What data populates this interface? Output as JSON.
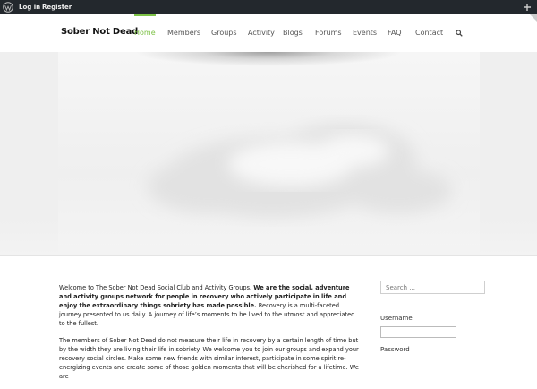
{
  "admin_bar": {
    "login": "Log in",
    "register": "Register",
    "icons": [
      "wordpress-icon",
      "add-icon"
    ]
  },
  "header": {
    "logo": "Sober Not Dead",
    "nav": [
      {
        "label": "Home",
        "active": true
      },
      {
        "label": "Members"
      },
      {
        "label": "Groups"
      },
      {
        "label": "Activity"
      },
      {
        "label": "Blogs"
      },
      {
        "label": "Forums"
      },
      {
        "label": "Events"
      },
      {
        "label": "FAQ"
      },
      {
        "label": "Contact"
      }
    ],
    "accent_color": "#7dc246",
    "search_icon": "search-icon"
  },
  "main": {
    "p1_a": "Welcome to The Sober Not Dead Social Club and Activity Groups. ",
    "p1_bold": "We are the social, adventure and activity groups network for people in recovery who actively participate in life and enjoy the extraordinary things sobriety has made possible.",
    "p1_b": " Recovery is a multi-faceted journey presented to us daily.  A journey of life’s moments to be lived to the utmost and appreciated to the fullest.",
    "p2": "The members of Sober Not Dead do not measure their life in recovery by a certain length of time but by the width they are living their life in sobriety.  We welcome you to join our groups and expand your recovery social circles. Make some new friends with similar interest, participate in some spirit re-energizing events and create some of those golden moments that will be cherished for a lifetime. We are"
  },
  "sidebar": {
    "search_placeholder": "Search ...",
    "username_label": "Username",
    "password_label": "Password"
  }
}
